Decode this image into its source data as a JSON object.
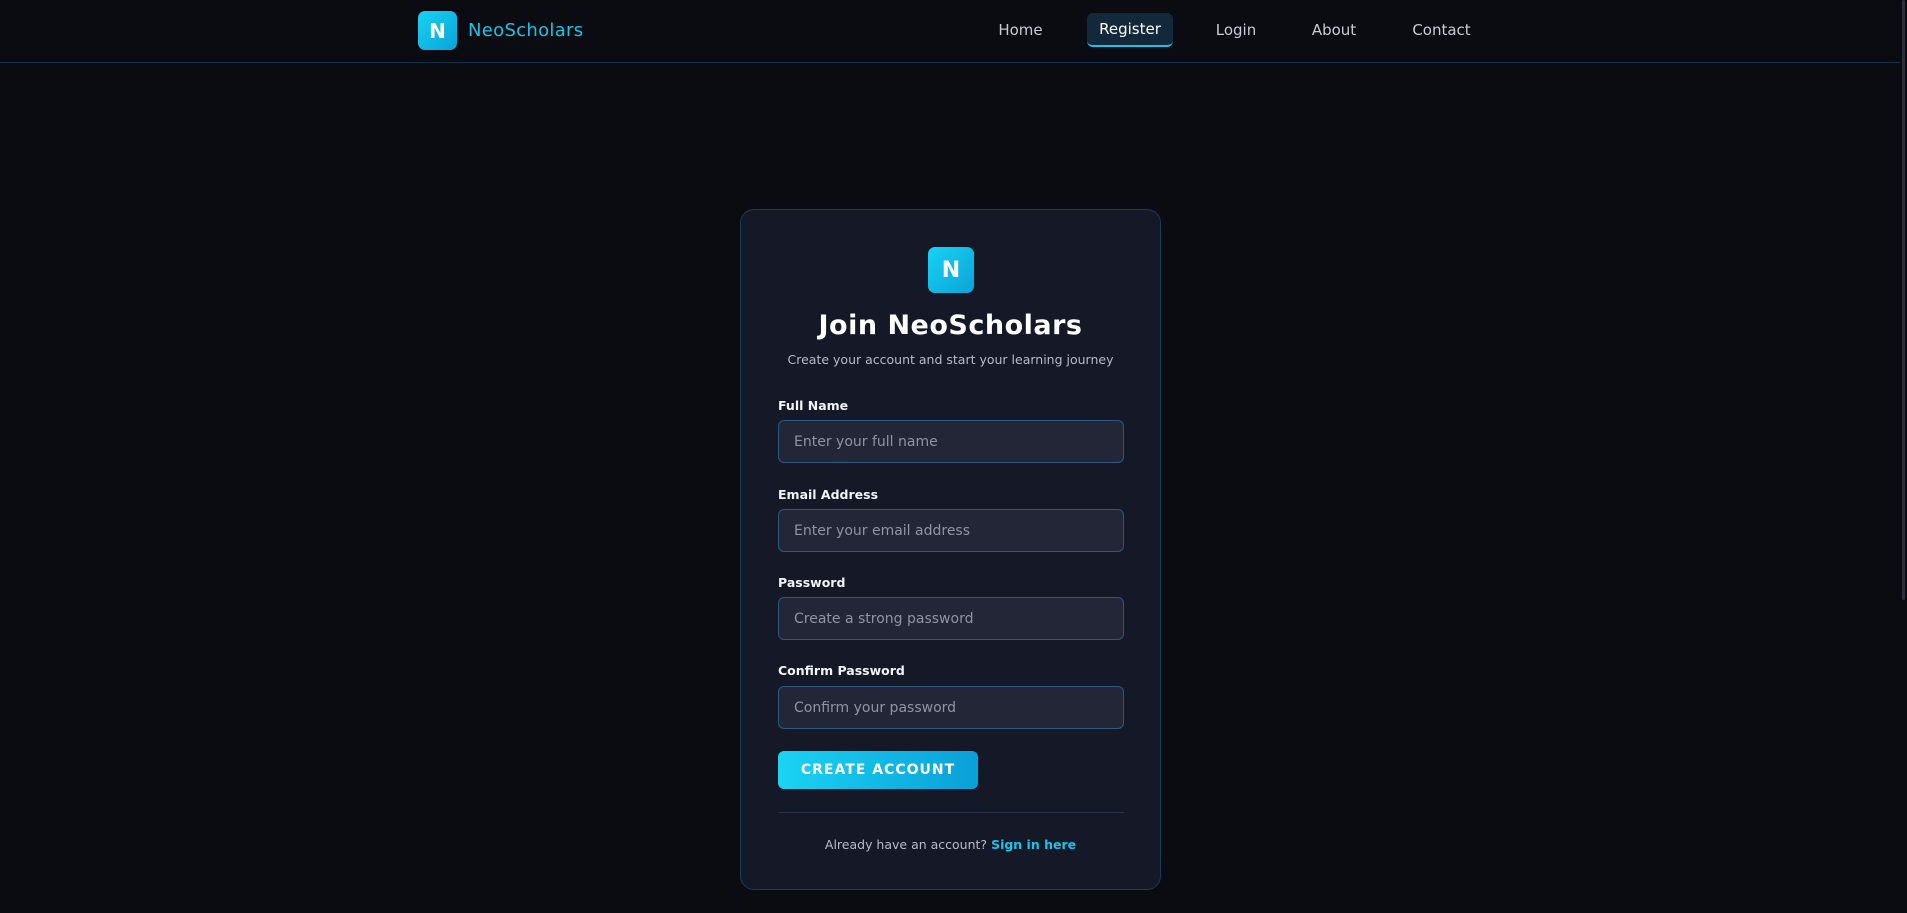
{
  "brand": {
    "logo_letter": "N",
    "name": "NeoScholars"
  },
  "nav": {
    "items": [
      {
        "label": "Home",
        "active": false
      },
      {
        "label": "Register",
        "active": true
      },
      {
        "label": "Login",
        "active": false
      },
      {
        "label": "About",
        "active": false
      },
      {
        "label": "Contact",
        "active": false
      }
    ]
  },
  "card": {
    "logo_letter": "N",
    "title": "Join NeoScholars",
    "subtitle": "Create your account and start your learning journey",
    "fields": {
      "full_name": {
        "label": "Full Name",
        "placeholder": "Enter your full name",
        "value": ""
      },
      "email": {
        "label": "Email Address",
        "placeholder": "Enter your email address",
        "value": ""
      },
      "password": {
        "label": "Password",
        "placeholder": "Create a strong password",
        "value": ""
      },
      "confirm_password": {
        "label": "Confirm Password",
        "placeholder": "Confirm your password",
        "value": ""
      }
    },
    "submit_label": "Create Account",
    "footer_text": "Already have an account?",
    "signin_link": "Sign in here"
  },
  "colors": {
    "accent": "#17c4ea",
    "background": "#0b0c11",
    "card": "#151826",
    "input": "#222636"
  }
}
